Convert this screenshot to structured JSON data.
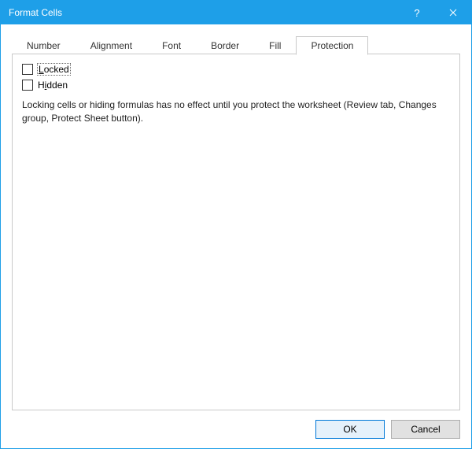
{
  "titlebar": {
    "title": "Format Cells",
    "help_symbol": "?",
    "close_symbol": "✕"
  },
  "tabs": {
    "number": "Number",
    "alignment": "Alignment",
    "font": "Font",
    "border": "Border",
    "fill": "Fill",
    "protection": "Protection"
  },
  "protection_tab": {
    "locked_prefix": "L",
    "locked_rest": "ocked",
    "hidden_pre": "H",
    "hidden_ul": "i",
    "hidden_rest": "dden",
    "description": "Locking cells or hiding formulas has no effect until you protect the worksheet (Review tab, Changes group, Protect Sheet button)."
  },
  "buttons": {
    "ok": "OK",
    "cancel": "Cancel"
  }
}
